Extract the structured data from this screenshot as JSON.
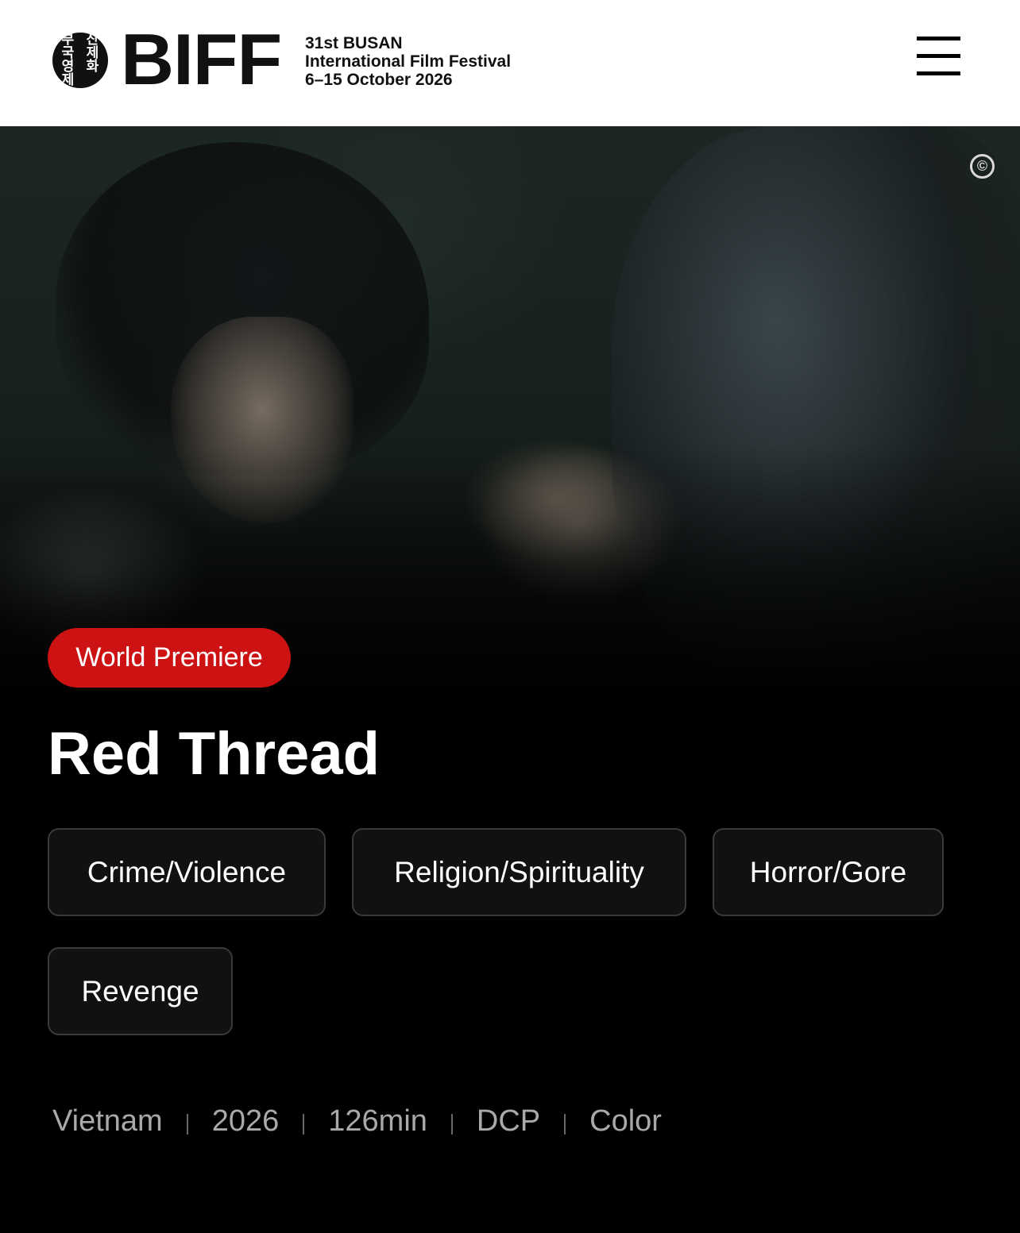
{
  "header": {
    "logo_text": "BIFF",
    "logo_seal_text": [
      "부",
      "산",
      "국",
      "제",
      "영",
      "화",
      "제",
      ""
    ],
    "festival_line1": "31st BUSAN",
    "festival_line2": "International Film Festival",
    "festival_line3": "6–15 October 2026",
    "menu_icon": "hamburger-menu-icon"
  },
  "hero": {
    "copyright_symbol": "©",
    "badge": "World Premiere",
    "title": "Red Thread"
  },
  "tags": [
    "Crime/Violence",
    "Religion/Spirituality",
    "Horror/Gore",
    "Revenge"
  ],
  "meta": {
    "country": "Vietnam",
    "year": "2026",
    "runtime": "126min",
    "format": "DCP",
    "color": "Color"
  },
  "colors": {
    "badge_red": "#cc1212",
    "background": "#000000",
    "tag_border": "#3a3a3a",
    "meta_text": "#a9a9a9"
  }
}
